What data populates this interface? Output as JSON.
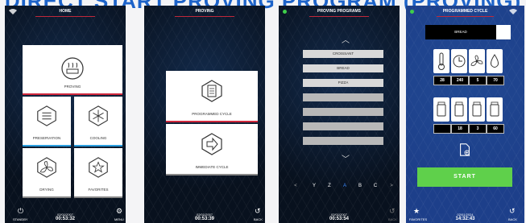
{
  "title": "DIRECT START PROVING PROGRAM (PROVING)",
  "screen1": {
    "header": "HOME",
    "tiles": {
      "proving": "PROVING",
      "preservation": "PRESERVATION",
      "cooling": "COOLING",
      "drying": "DRYING",
      "favorites": "FAVORITES"
    },
    "footer": {
      "standby": "STANDBY",
      "date": "02/01/2007",
      "time": "00:53:32",
      "menu": "MENU"
    }
  },
  "screen2": {
    "header": "PROVING",
    "tiles": {
      "programmed": "PROGRAMMED CYCLE",
      "immediate": "IMMEDIATE CYCLE"
    },
    "footer": {
      "date": "02/01/2007",
      "time": "00:53:39",
      "back": "BACK"
    }
  },
  "screen3": {
    "header": "PROVING PROGRAMS",
    "programs": [
      "CROISSANT",
      "BREAD",
      "PIZZA",
      "",
      "",
      "",
      "",
      ""
    ],
    "alphabet": [
      "<",
      "Y",
      "Z",
      "A",
      "B",
      "C",
      ">"
    ],
    "active_letter": "A",
    "footer": {
      "date": "02/01/2007",
      "time": "00:53:54",
      "back": "BACK"
    }
  },
  "screen4": {
    "header": "PROGRAMMED CYCLE",
    "program_name": "BREAD",
    "row1_values": [
      "28",
      "240",
      "5",
      "70"
    ],
    "row2_values": [
      "",
      "18",
      "3",
      "60"
    ],
    "start": "START",
    "footer": {
      "favorites": "FAVORITES",
      "date": "02/01/2024",
      "time": "14:32:43",
      "back": "BACK"
    }
  },
  "colors": {
    "accent_red": "#d0283c",
    "start_green": "#5fd04b",
    "title_blue": "#1d63c9"
  }
}
